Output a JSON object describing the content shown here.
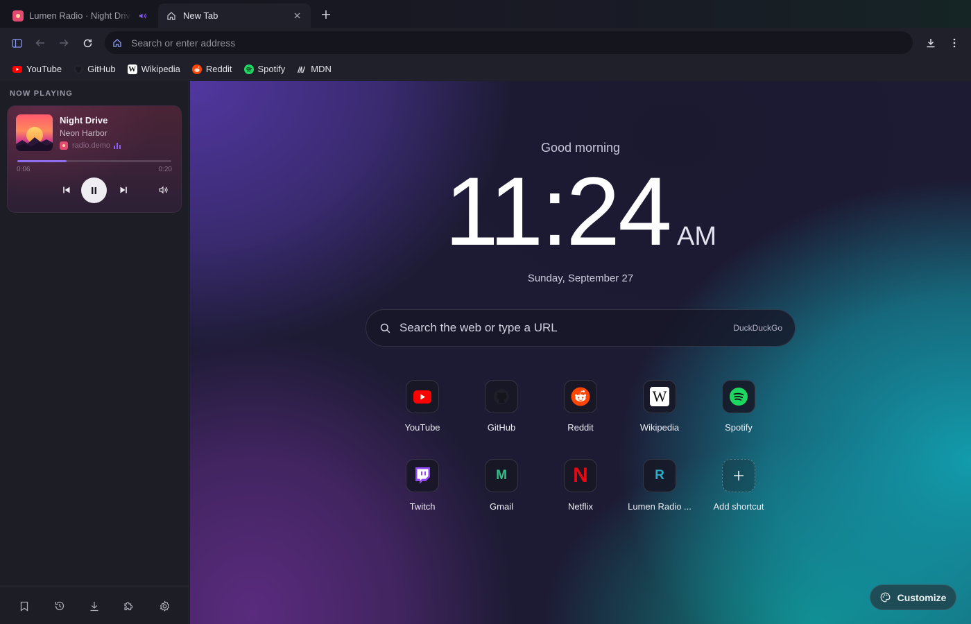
{
  "tabs": [
    {
      "title": "Lumen Radio · Night Drive",
      "icon": "radio-favicon",
      "audio_icon": "speaker-icon"
    },
    {
      "title": "New Tab",
      "icon": "home-icon",
      "close_icon": "close-icon"
    }
  ],
  "toolbar": {
    "address_placeholder": "Search or enter address",
    "icons": [
      "sidebar-toggle-icon",
      "back-arrow-icon",
      "forward-arrow-icon",
      "reload-icon",
      "home-icon",
      "download-icon",
      "more-vertical-icon"
    ]
  },
  "bookmarks": [
    {
      "label": "YouTube"
    },
    {
      "label": "GitHub"
    },
    {
      "label": "Wikipedia"
    },
    {
      "label": "Reddit"
    },
    {
      "label": "Spotify"
    },
    {
      "label": "MDN"
    }
  ],
  "sidebar": {
    "heading": "NOW PLAYING",
    "player": {
      "title": "Night Drive",
      "artist": "Neon Harbor",
      "source": "radio.demo",
      "elapsed": "0:06",
      "total": "0:20",
      "progress": 0.32
    },
    "footer_icons": [
      "bookmark-icon",
      "history-icon",
      "download-icon",
      "puzzle-icon",
      "gear-icon"
    ]
  },
  "ntp": {
    "greeting": "Good morning",
    "time": "11:24",
    "ampm": "AM",
    "date": "Sunday, September 27",
    "search_placeholder": "Search the web or type a URL",
    "search_engine": "DuckDuckGo",
    "shortcuts": [
      {
        "label": "YouTube"
      },
      {
        "label": "GitHub"
      },
      {
        "label": "Reddit"
      },
      {
        "label": "Wikipedia"
      },
      {
        "label": "Spotify"
      },
      {
        "label": "Twitch"
      },
      {
        "label": "Gmail",
        "letter": "M"
      },
      {
        "label": "Netflix",
        "letter": "N"
      },
      {
        "label": "Lumen Radio ...",
        "letter": "R"
      },
      {
        "label": "Add shortcut"
      }
    ],
    "customize_label": "Customize"
  },
  "colors": {
    "accent": "#8b5cf6",
    "youtube": "#ff0000",
    "reddit": "#ff4500",
    "spotify": "#1ed760",
    "twitch": "#9146ff",
    "netflix": "#e50914",
    "gmail": "#34c08a",
    "lumen": "#2ba9c9"
  }
}
